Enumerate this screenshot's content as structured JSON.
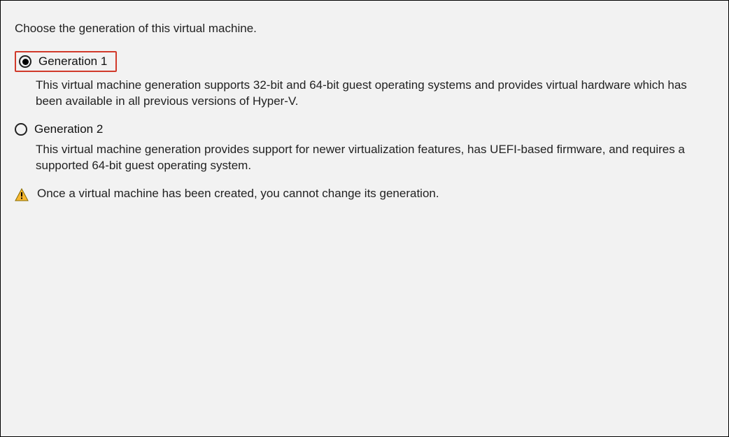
{
  "instruction": "Choose the generation of this virtual machine.",
  "options": {
    "gen1": {
      "label": "Generation 1",
      "description": "This virtual machine generation supports 32-bit and 64-bit guest operating systems and provides virtual hardware which has been available in all previous versions of Hyper-V.",
      "selected": true
    },
    "gen2": {
      "label": "Generation 2",
      "description": "This virtual machine generation provides support for newer virtualization features, has UEFI-based firmware, and requires a supported 64-bit guest operating system.",
      "selected": false
    }
  },
  "warning": "Once a virtual machine has been created, you cannot change its generation."
}
